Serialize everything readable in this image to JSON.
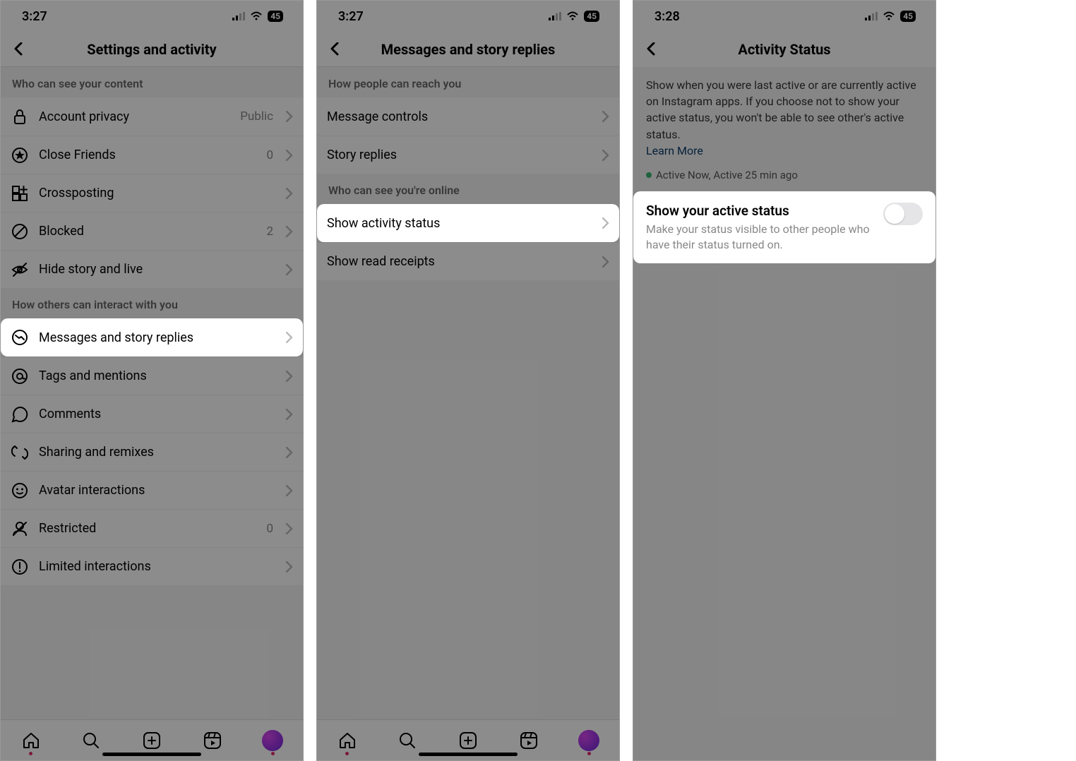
{
  "screen1": {
    "time": "3:27",
    "battery": "45",
    "title": "Settings and activity",
    "section1": "Who can see your content",
    "rows1": [
      {
        "icon": "lock",
        "label": "Account privacy",
        "value": "Public"
      },
      {
        "icon": "star",
        "label": "Close Friends",
        "value": "0"
      },
      {
        "icon": "cross",
        "label": "Crossposting",
        "value": ""
      },
      {
        "icon": "block",
        "label": "Blocked",
        "value": "2"
      },
      {
        "icon": "hide",
        "label": "Hide story and live",
        "value": ""
      }
    ],
    "section2": "How others can interact with you",
    "rows2": [
      {
        "icon": "msg",
        "label": "Messages and story replies",
        "value": "",
        "hl": true
      },
      {
        "icon": "at",
        "label": "Tags and mentions",
        "value": ""
      },
      {
        "icon": "comment",
        "label": "Comments",
        "value": ""
      },
      {
        "icon": "share",
        "label": "Sharing and remixes",
        "value": ""
      },
      {
        "icon": "avatar",
        "label": "Avatar interactions",
        "value": ""
      },
      {
        "icon": "restrict",
        "label": "Restricted",
        "value": "0"
      },
      {
        "icon": "limit",
        "label": "Limited interactions",
        "value": ""
      }
    ]
  },
  "screen2": {
    "time": "3:27",
    "battery": "45",
    "title": "Messages and story replies",
    "section1": "How people can reach you",
    "rows1": [
      {
        "label": "Message controls"
      },
      {
        "label": "Story replies"
      }
    ],
    "section2": "Who can see you're online",
    "rows2": [
      {
        "label": "Show activity status",
        "hl": true
      },
      {
        "label": "Show read receipts"
      }
    ]
  },
  "screen3": {
    "time": "3:28",
    "battery": "45",
    "title": "Activity Status",
    "desc": "Show when you were last active or are currently active on Instagram apps. If you choose not to show your active status, you won't be able to see other's active status.",
    "learn": "Learn More",
    "statusline": "Active Now, Active 25 min ago",
    "toggle_title": "Show your active status",
    "toggle_sub": "Make your status visible to other people who have their status turned on."
  }
}
